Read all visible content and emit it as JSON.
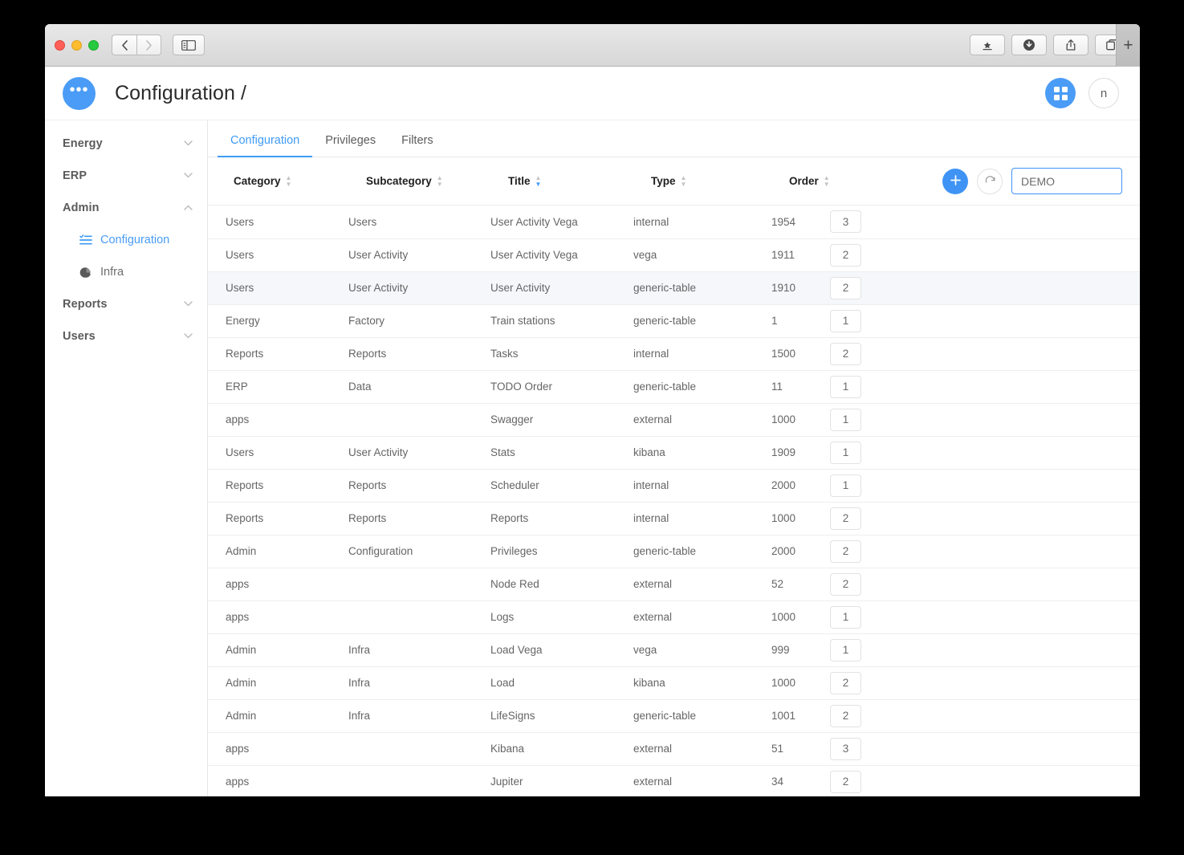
{
  "browser": {
    "back_icon": "chevron-left-icon",
    "forward_icon": "chevron-right-icon",
    "sidebar_icon": "sidebar-toggle-icon",
    "bookmark_icon": "bookmark-star-icon",
    "download_icon": "download-icon",
    "share_icon": "share-icon",
    "tabs_icon": "tab-overview-icon",
    "new_tab_label": "+"
  },
  "header": {
    "logo_label": "•••",
    "title": "Configuration /",
    "grid_icon": "grid-apps-icon",
    "avatar_initial": "n",
    "accent_color": "#4a9cf6"
  },
  "sidebar": {
    "groups": [
      {
        "label": "Energy",
        "expanded": false,
        "chevron": "chevron-down-icon"
      },
      {
        "label": "ERP",
        "expanded": false,
        "chevron": "chevron-down-icon"
      },
      {
        "label": "Admin",
        "expanded": true,
        "chevron": "chevron-up-icon"
      },
      {
        "label": "Reports",
        "expanded": false,
        "chevron": "chevron-down-icon"
      },
      {
        "label": "Users",
        "expanded": false,
        "chevron": "chevron-down-icon"
      }
    ],
    "admin_children": [
      {
        "label": "Configuration",
        "icon": "list-config-icon",
        "active": true
      },
      {
        "label": "Infra",
        "icon": "pie-chart-icon",
        "active": false
      }
    ]
  },
  "tabs": [
    {
      "label": "Configuration",
      "active": true
    },
    {
      "label": "Privileges",
      "active": false
    },
    {
      "label": "Filters",
      "active": false
    }
  ],
  "toolbar": {
    "columns": [
      {
        "label": "Category",
        "sort": "none"
      },
      {
        "label": "Subcategory",
        "sort": "none"
      },
      {
        "label": "Title",
        "sort": "desc"
      },
      {
        "label": "Type",
        "sort": "none"
      },
      {
        "label": "Order",
        "sort": "none"
      }
    ],
    "add_label": "+",
    "add_icon": "plus-icon",
    "refresh_icon": "refresh-icon",
    "search_value": "DEMO",
    "search_placeholder": "DEMO"
  },
  "table": {
    "rows": [
      {
        "category": "Users",
        "subcategory": "Users",
        "title": "User Activity Vega",
        "type": "internal",
        "order": "1954",
        "num": "3",
        "icon": "user-icon",
        "selected": false
      },
      {
        "category": "Users",
        "subcategory": "User Activity",
        "title": "User Activity Vega",
        "type": "vega",
        "order": "1911",
        "num": "2",
        "icon": "users-icon",
        "selected": false
      },
      {
        "category": "Users",
        "subcategory": "User Activity",
        "title": "User Activity",
        "type": "generic-table",
        "order": "1910",
        "num": "2",
        "icon": "users-icon",
        "selected": true
      },
      {
        "category": "Energy",
        "subcategory": "Factory",
        "title": "Train stations",
        "type": "generic-table",
        "order": "1",
        "num": "1",
        "icon": "train-icon",
        "selected": false
      },
      {
        "category": "Reports",
        "subcategory": "Reports",
        "title": "Tasks",
        "type": "internal",
        "order": "1500",
        "num": "2",
        "icon": "none",
        "selected": false
      },
      {
        "category": "ERP",
        "subcategory": "Data",
        "title": "TODO Order",
        "type": "generic-table",
        "order": "11",
        "num": "1",
        "icon": "box-icon",
        "selected": false
      },
      {
        "category": "apps",
        "subcategory": "",
        "title": "Swagger",
        "type": "external",
        "order": "1000",
        "num": "1",
        "icon": "spider-icon",
        "selected": false
      },
      {
        "category": "Users",
        "subcategory": "User Activity",
        "title": "Stats",
        "type": "kibana",
        "order": "1909",
        "num": "1",
        "icon": "users-icon",
        "selected": false
      },
      {
        "category": "Reports",
        "subcategory": "Reports",
        "title": "Scheduler",
        "type": "internal",
        "order": "2000",
        "num": "1",
        "icon": "none",
        "selected": false
      },
      {
        "category": "Reports",
        "subcategory": "Reports",
        "title": "Reports",
        "type": "internal",
        "order": "1000",
        "num": "2",
        "icon": "word-file-icon",
        "selected": false
      },
      {
        "category": "Admin",
        "subcategory": "Configuration",
        "title": "Privileges",
        "type": "generic-table",
        "order": "2000",
        "num": "2",
        "icon": "cogs-icon",
        "selected": false
      },
      {
        "category": "apps",
        "subcategory": "",
        "title": "Node Red",
        "type": "external",
        "order": "52",
        "num": "2",
        "icon": "cogs-icon",
        "selected": false
      },
      {
        "category": "apps",
        "subcategory": "",
        "title": "Logs",
        "type": "external",
        "order": "1000",
        "num": "1",
        "icon": "file-icon",
        "selected": false
      },
      {
        "category": "Admin",
        "subcategory": "Infra",
        "title": "Load Vega",
        "type": "vega",
        "order": "999",
        "num": "1",
        "icon": "none",
        "selected": false
      },
      {
        "category": "Admin",
        "subcategory": "Infra",
        "title": "Load",
        "type": "kibana",
        "order": "1000",
        "num": "2",
        "icon": "server-icon",
        "selected": false
      },
      {
        "category": "Admin",
        "subcategory": "Infra",
        "title": "LifeSigns",
        "type": "generic-table",
        "order": "1001",
        "num": "2",
        "icon": "none",
        "selected": false
      },
      {
        "category": "apps",
        "subcategory": "",
        "title": "Kibana",
        "type": "external",
        "order": "51",
        "num": "3",
        "icon": "pie-chart-icon",
        "selected": false
      },
      {
        "category": "apps",
        "subcategory": "",
        "title": "Jupiter",
        "type": "external",
        "order": "34",
        "num": "2",
        "icon": "code-icon",
        "selected": false
      }
    ],
    "gear_icon": "gear-icon",
    "delete_icon": "trash-icon"
  }
}
